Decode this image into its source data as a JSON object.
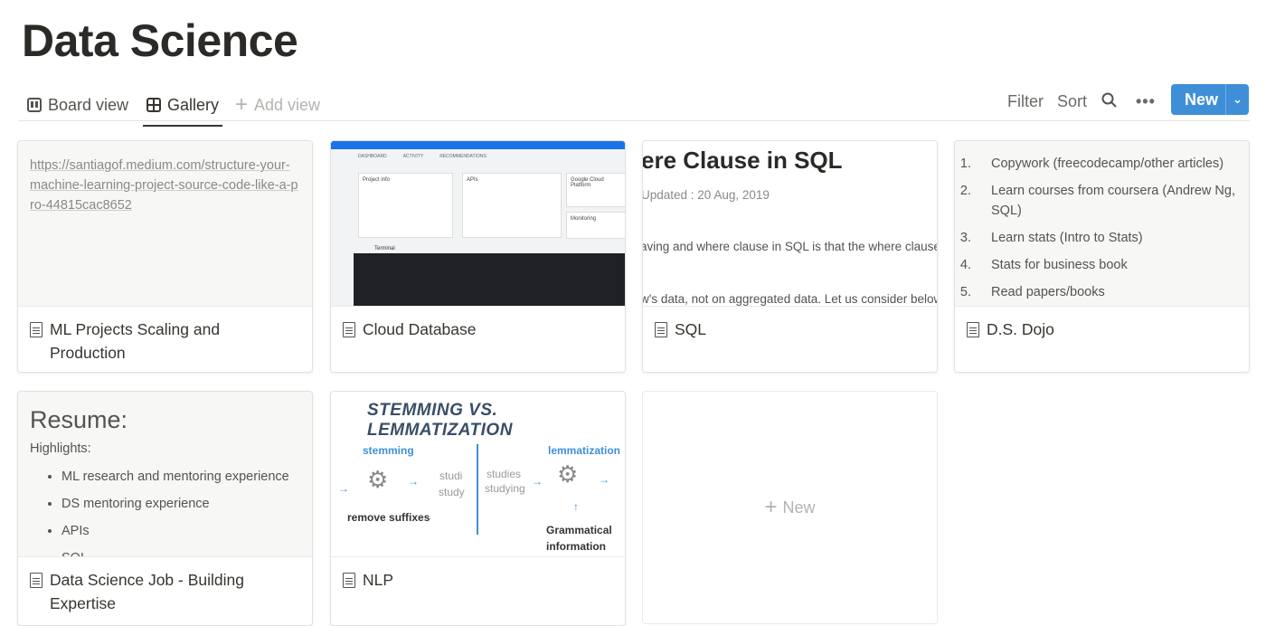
{
  "page": {
    "title": "Data Science"
  },
  "views": {
    "tabs": [
      {
        "label": "Board view",
        "icon": "board-icon"
      },
      {
        "label": "Gallery",
        "icon": "gallery-icon",
        "active": true
      }
    ],
    "add_view": "Add view"
  },
  "toolbar": {
    "filter": "Filter",
    "sort": "Sort",
    "new": "New",
    "accent": "#3f8fd8"
  },
  "cards": [
    {
      "title": "ML Projects Scaling and Production",
      "preview_url": "https://santiagof.medium.com/structure-your-machine-learning-project-source-code-like-a-pro-44815cac8652"
    },
    {
      "title": "Cloud Database",
      "preview": {
        "tabs": [
          "DASHBOARD",
          "ACTIVITY",
          "RECOMMENDATIONS"
        ],
        "panels": [
          "Project info",
          "APIs",
          "Google Cloud Platform",
          "Monitoring"
        ],
        "terminal": "Terminal"
      }
    },
    {
      "title": "SQL",
      "preview": {
        "heading": "ere Clause in SQL",
        "updated": "Updated : 20 Aug, 2019",
        "line1": "aving and where clause in SQL is that the where clause c",
        "line2": "w's data, not on aggregated data.  Let us consider below"
      }
    },
    {
      "title": "D.S. Dojo",
      "preview_list": [
        "Copywork (freecodecamp/other articles)",
        "Learn courses from coursera (Andrew Ng, SQL)",
        "Learn stats (Intro to Stats)",
        "Stats for business book",
        "Read papers/books"
      ]
    },
    {
      "title": "Data Science Job - Building Expertise",
      "preview": {
        "heading": "Resume:",
        "sub": "Highlights:",
        "items": [
          "ML research and mentoring experience",
          "DS mentoring experience",
          "APIs",
          "SQL"
        ]
      }
    },
    {
      "title": "NLP",
      "preview": {
        "heading": "STEMMING VS. LEMMATIZATION",
        "stemming": "stemming",
        "lemmatization": "lemmatization",
        "remove": "remove suffixes",
        "out1": "studi",
        "out2": "study",
        "in1": "studies",
        "in2": "studying",
        "gram1": "Grammatical",
        "gram2": "information"
      }
    }
  ],
  "new_card": "New"
}
